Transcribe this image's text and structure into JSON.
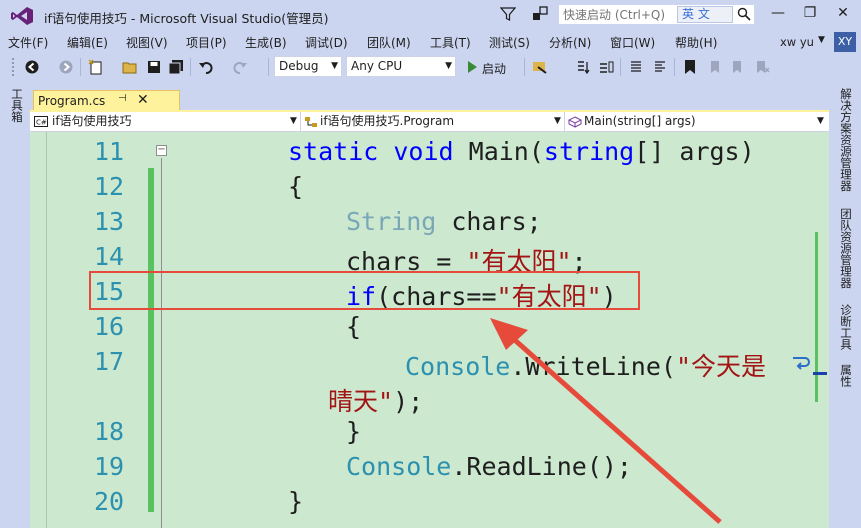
{
  "window": {
    "title": "if语句使用技巧 - Microsoft Visual Studio(管理员)",
    "quick_launch_placeholder": "快速启动 (Ctrl+Q)",
    "ime_label": "英 文",
    "minimize": "—",
    "restore": "❐",
    "close": "✕"
  },
  "menu": {
    "items": [
      "文件(F)",
      "编辑(E)",
      "视图(V)",
      "项目(P)",
      "生成(B)",
      "调试(D)",
      "团队(M)",
      "工具(T)",
      "测试(S)",
      "分析(N)",
      "窗口(W)",
      "帮助(H)"
    ],
    "user_name": "xw yu",
    "avatar_initials": "XY"
  },
  "toolbar": {
    "config": "Debug",
    "platform": "Any CPU",
    "start_label": "启动"
  },
  "left_strip": {
    "toolbox_label": "工具箱"
  },
  "right_strip": {
    "items": [
      "解决方案资源管理器",
      "团队资源管理器",
      "诊断工具",
      "属性"
    ]
  },
  "document": {
    "tab_name": "Program.cs",
    "tab_pin": "⊣",
    "tab_close": "✕",
    "nav_project": "if语句使用技巧",
    "nav_class": "if语句使用技巧.Program",
    "nav_member": "Main(string[] args)"
  },
  "code": {
    "line_numbers": [
      "11",
      "12",
      "13",
      "14",
      "15",
      "16",
      "17",
      "18",
      "19",
      "20"
    ],
    "l11_kw1": "static",
    "l11_kw2": "void",
    "l11_name": "Main(",
    "l11_type": "string",
    "l11_rest": "[] args)",
    "l12": "{",
    "l13_type": "String",
    "l13_rest": " chars;",
    "l14_start": "chars = ",
    "l14_str": "\"有太阳\"",
    "l14_end": ";",
    "l15_kw": "if",
    "l15_mid": "(chars==",
    "l15_str": "\"有太阳\"",
    "l15_end": ")",
    "l16": "{",
    "l17_type": "Console",
    "l17_rest": ".WriteLine(",
    "l17_str": "\"今天是",
    "l17b_str": "晴天\"",
    "l17b_end": ");",
    "l18": "}",
    "l19_type": "Console",
    "l19_rest": ".ReadLine();",
    "l20": "}"
  },
  "colors": {
    "editor_bg": "#cce8cf",
    "keyword": "#0000ff",
    "type": "#2b91af",
    "string": "#a31515",
    "annotation": "#e64a3b",
    "change_bar": "#57c25f"
  }
}
